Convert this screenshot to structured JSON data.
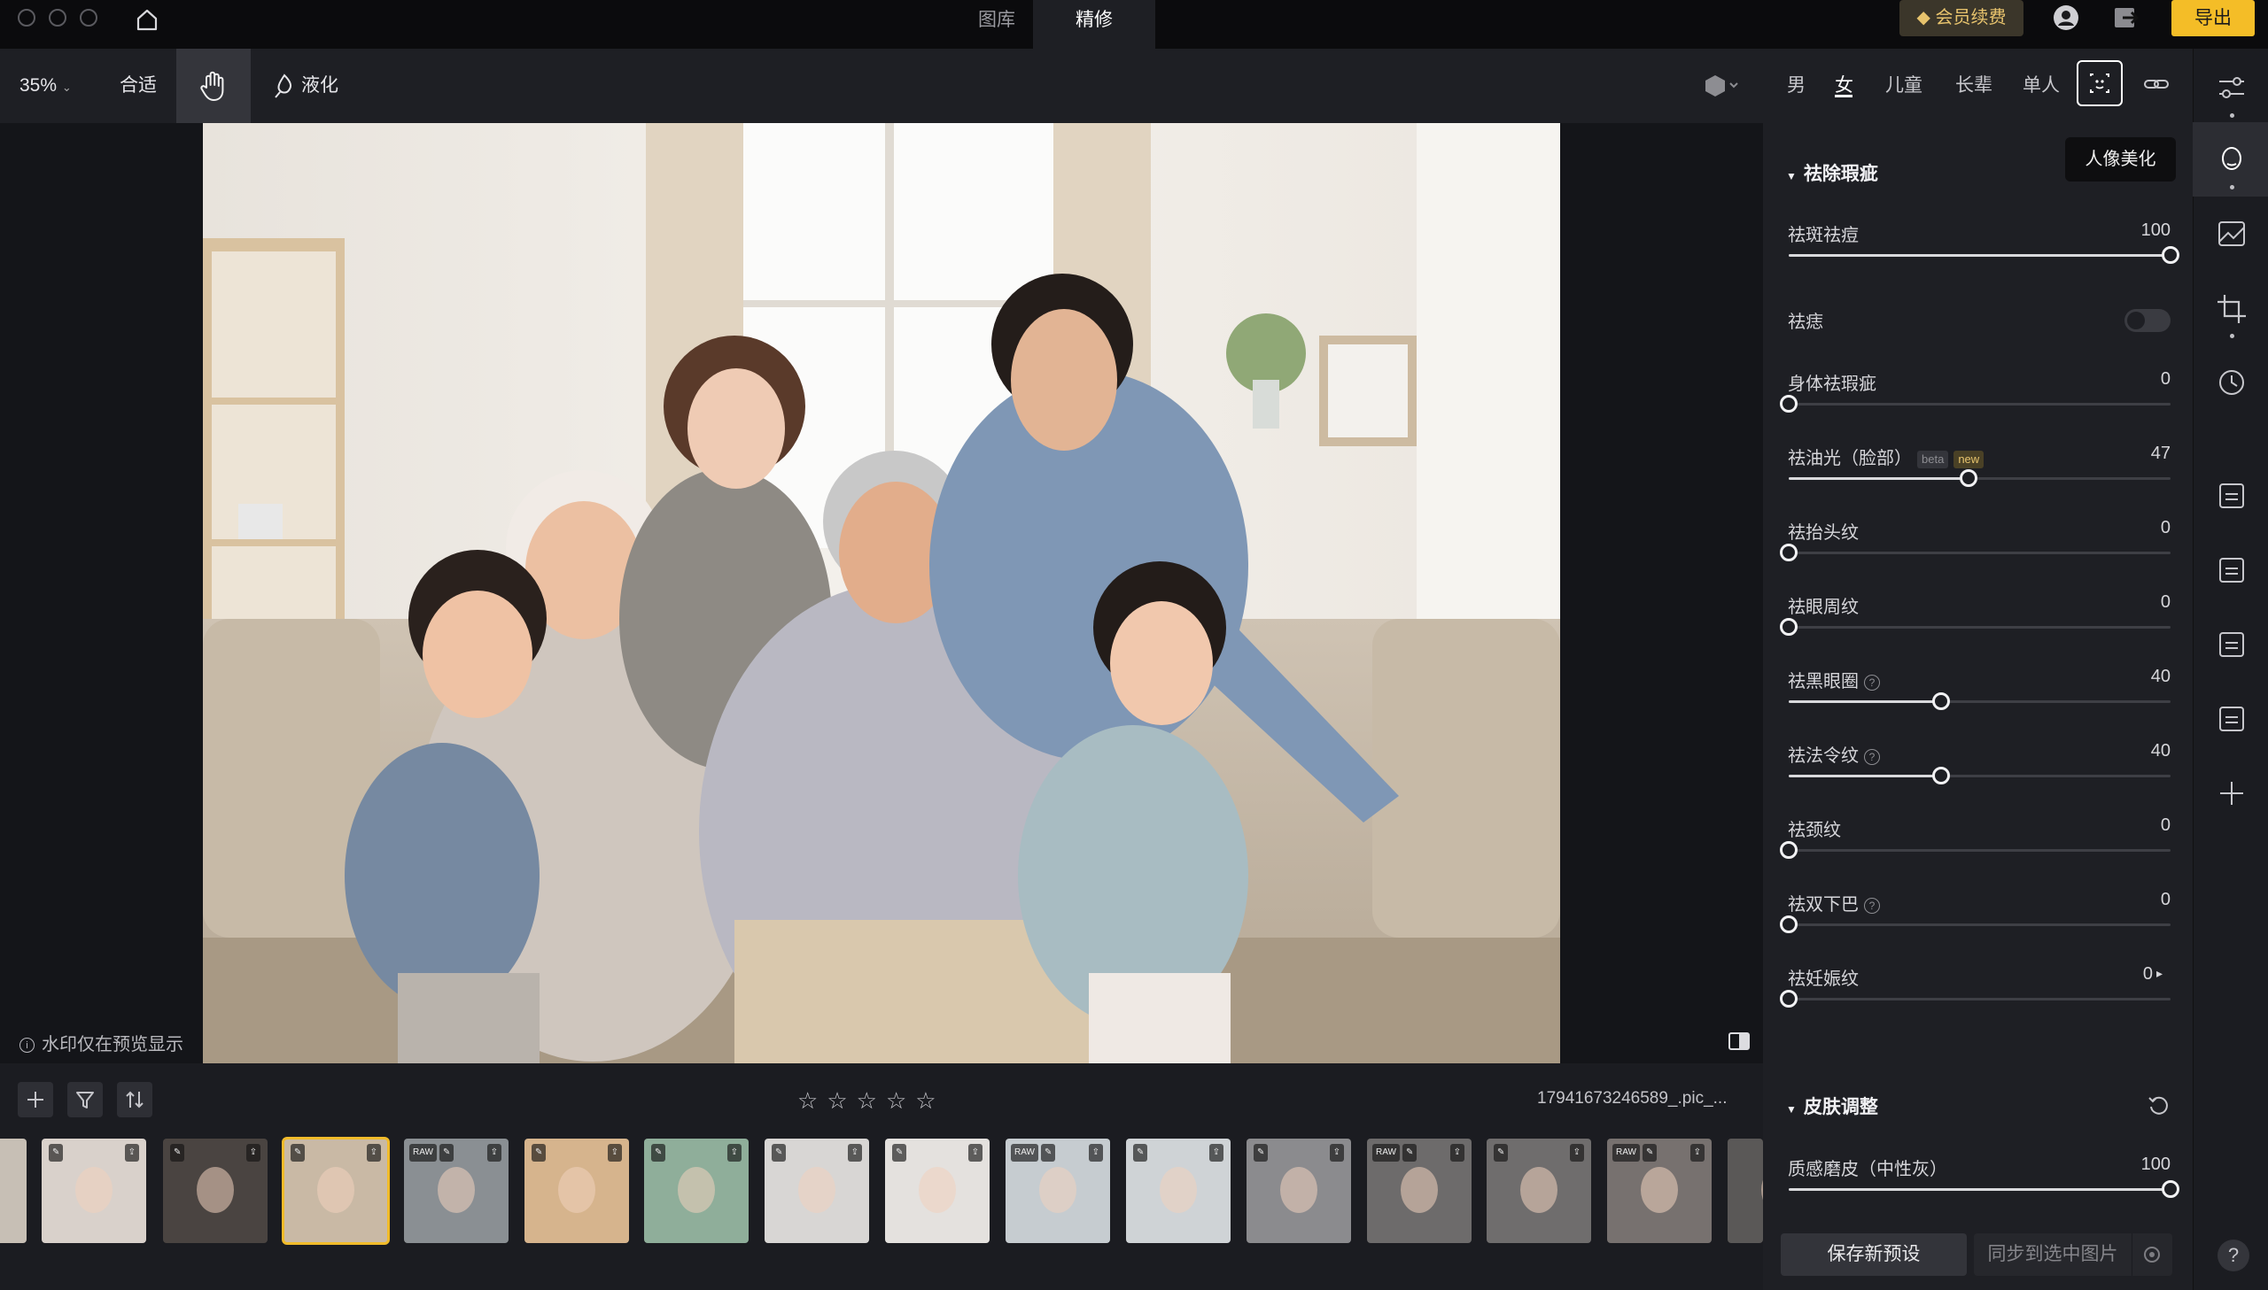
{
  "titlebar": {
    "nav": [
      "图库",
      "精修"
    ],
    "vip_label": "会员续费",
    "export_label": "导出"
  },
  "toolbar": {
    "zoom": "35%",
    "fit_label": "合适",
    "liquify_label": "液化"
  },
  "canvas": {
    "watermark_note": "水印仅在预览显示"
  },
  "filmstrip": {
    "filename": "17941673246589_.pic_...",
    "rating_stars": 5,
    "raw_tag": "RAW"
  },
  "panel": {
    "tabs": [
      "男",
      "女",
      "儿童",
      "长辈",
      "单人"
    ],
    "active_tab": "女",
    "tooltip": "人像美化",
    "blemish_section": {
      "title": "祛除瑕疵",
      "rows": [
        {
          "label": "祛斑祛痘",
          "value": "100",
          "fraction": 1.0
        },
        {
          "label": "祛痣",
          "toggle": false
        },
        {
          "label": "身体祛瑕疵",
          "value": "0",
          "fraction": 0.0
        },
        {
          "label": "祛油光（脸部）",
          "value": "47",
          "fraction": 0.47,
          "badges": [
            "beta",
            "new"
          ]
        },
        {
          "label": "祛抬头纹",
          "value": "0",
          "fraction": 0.0
        },
        {
          "label": "祛眼周纹",
          "value": "0",
          "fraction": 0.0
        },
        {
          "label": "祛黑眼圈",
          "value": "40",
          "fraction": 0.4,
          "help": true
        },
        {
          "label": "祛法令纹",
          "value": "40",
          "fraction": 0.4,
          "help": true
        },
        {
          "label": "祛颈纹",
          "value": "0",
          "fraction": 0.0
        },
        {
          "label": "祛双下巴",
          "value": "0",
          "fraction": 0.0,
          "help": true
        },
        {
          "label": "祛妊娠纹",
          "value": "0",
          "fraction": 0.0,
          "arrow": true
        }
      ]
    },
    "skin_section": {
      "title": "皮肤调整",
      "rows": [
        {
          "label": "质感磨皮（中性灰）",
          "value": "100",
          "fraction": 1.0
        }
      ]
    },
    "save_preset_label": "保存新预设",
    "sync_label": "同步到选中图片"
  },
  "colors": {
    "accent": "#f4bd27",
    "vip_text": "#e7c36d",
    "panel_bg": "#1e1f24"
  }
}
